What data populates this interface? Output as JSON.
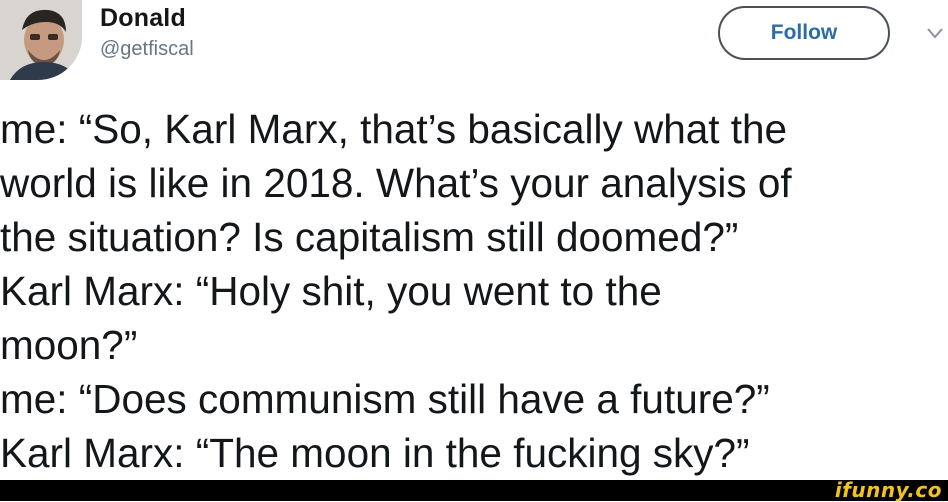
{
  "tweet": {
    "author": {
      "display_name": "Donald",
      "handle": "@getfiscal"
    },
    "follow_label": "Follow",
    "lines": [
      "me: “So, Karl Marx, that’s basically what the",
      "world is like in 2018. What’s your analysis of",
      "the situation? Is capitalism still doomed?”",
      "Karl Marx: “Holy shit, you went to the",
      "moon?”",
      "me: “Does communism still have a future?”",
      "Karl Marx: “The moon in the fucking sky?”"
    ]
  },
  "watermark": "ifunny.co",
  "icons": {
    "avatar": "avatar-photo",
    "menu": "chevron-down-icon"
  },
  "colors": {
    "name": "#14171a",
    "handle": "#657786",
    "follow_text": "#2b6ea6",
    "watermark": "#f4c31b",
    "footer": "#000000"
  }
}
